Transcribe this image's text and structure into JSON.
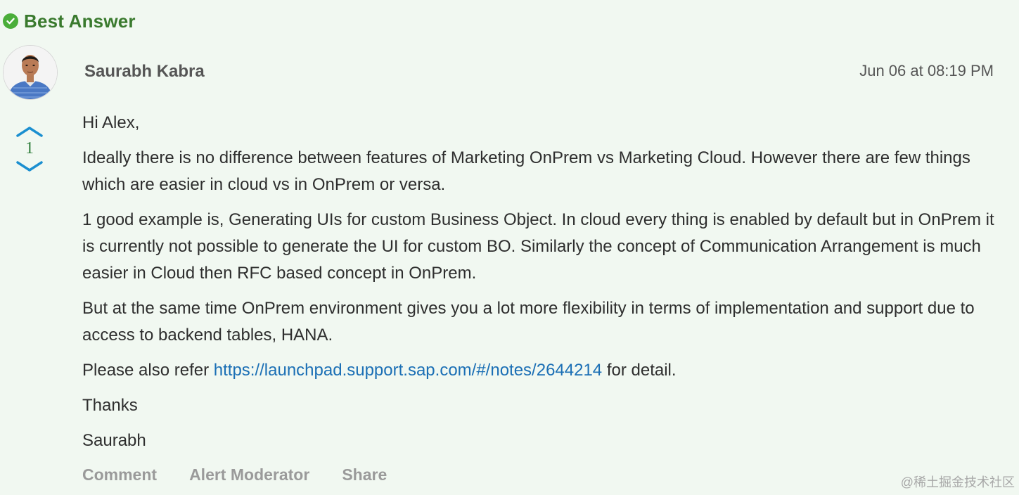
{
  "best_answer": {
    "label": "Best Answer",
    "icon": "check-circle-icon",
    "color": "#4aae3a"
  },
  "post": {
    "author": "Saurabh Kabra",
    "timestamp": "Jun 06 at 08:19 PM",
    "votes": "1",
    "body": {
      "greeting": "Hi Alex,",
      "para1": "Ideally there is no difference between features of Marketing OnPrem vs Marketing Cloud. However there are few things which are easier in cloud vs in OnPrem or versa.",
      "para2": "1 good example is, Generating UIs for custom Business Object. In cloud every thing is enabled by default but in OnPrem it is currently not possible to generate the UI for custom BO. Similarly the concept of Communication Arrangement is much easier in Cloud then RFC based concept in OnPrem.",
      "para3": "But at the same time OnPrem environment gives you a lot more flexibility in terms of implementation and support due to access to backend tables, HANA.",
      "refer_prefix": "Please also refer ",
      "refer_link": "https://launchpad.support.sap.com/#/notes/2644214",
      "refer_suffix": " for detail.",
      "thanks": "Thanks",
      "signature": "Saurabh"
    }
  },
  "actions": {
    "comment": "Comment",
    "alert": "Alert Moderator",
    "share": "Share"
  },
  "watermark": "@稀土掘金技术社区",
  "colors": {
    "background": "#f1f8f1",
    "accent": "#1b8fd0",
    "link": "#1b6fb5",
    "best_answer_text": "#3a7a2e"
  }
}
